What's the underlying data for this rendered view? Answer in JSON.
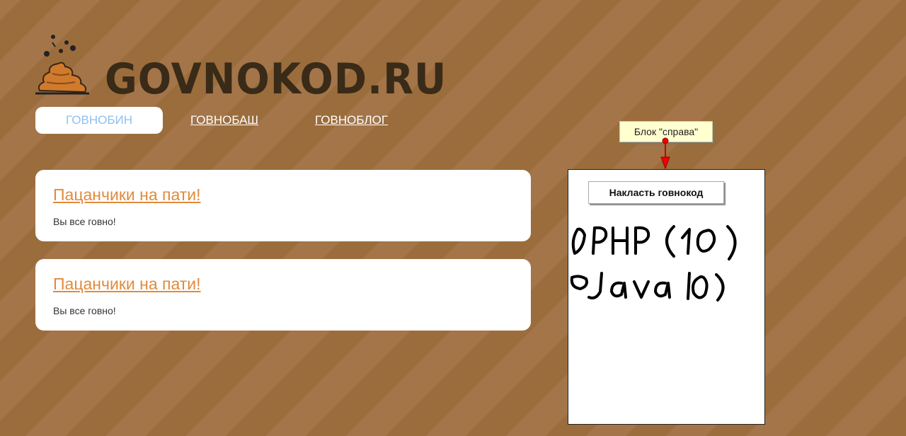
{
  "site": {
    "logo_text": "GOVNOKOD.RU"
  },
  "nav": [
    {
      "label": "ГОВНОБИН",
      "active": true
    },
    {
      "label": "ГОВНОБАШ",
      "active": false
    },
    {
      "label": "ГОВНОБЛОГ",
      "active": false
    }
  ],
  "posts": [
    {
      "title": "Пацанчики на пати!",
      "body": "Вы все говно!"
    },
    {
      "title": "Пацанчики на пати!",
      "body": "Вы все говно!"
    }
  ],
  "sidebar": {
    "annotation": "Блок \"справа\"",
    "post_button": "Накласть говнокод",
    "handwritten_items": [
      "PHP (10)",
      "Java (0)"
    ]
  }
}
